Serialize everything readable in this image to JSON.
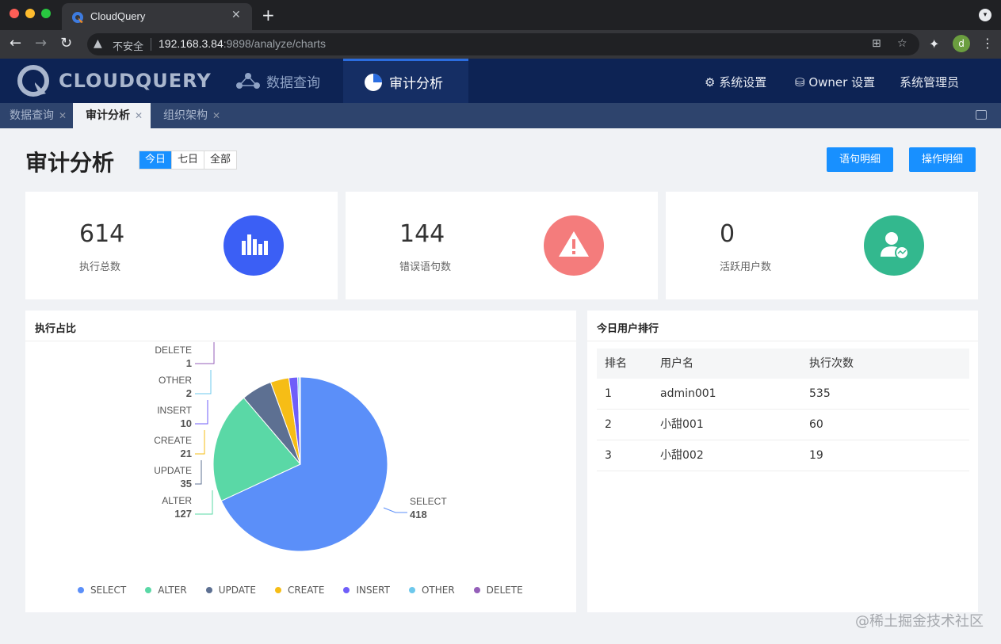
{
  "browser": {
    "tab_title": "CloudQuery",
    "insecure_label": "不安全",
    "url_host": "192.168.3.84",
    "url_rest": ":9898/analyze/charts",
    "profile_initial": "d"
  },
  "app": {
    "logo_text": "CLOUDQUERY",
    "nav": [
      "数据查询",
      "审计分析"
    ],
    "nav_right": [
      "系统设置",
      "Owner 设置",
      "系统管理员"
    ]
  },
  "page_tabs": [
    "数据查询",
    "审计分析",
    "组织架构"
  ],
  "page": {
    "title": "审计分析",
    "range_options": [
      "今日",
      "七日",
      "全部"
    ],
    "range_selected": "今日",
    "buttons": [
      "语句明细",
      "操作明细"
    ]
  },
  "stats": [
    {
      "value": "614",
      "label": "执行总数",
      "color": "#3b5ff5",
      "icon": "bar-chart-icon"
    },
    {
      "value": "144",
      "label": "错误语句数",
      "color": "#f47c7c",
      "icon": "warning-icon"
    },
    {
      "value": "0",
      "label": "活跃用户数",
      "color": "#33b88e",
      "icon": "user-activity-icon"
    }
  ],
  "pie_panel": {
    "title": "执行占比"
  },
  "ranking": {
    "title": "今日用户排行",
    "headers": [
      "排名",
      "用户名",
      "执行次数"
    ],
    "rows": [
      [
        "1",
        "admin001",
        "535"
      ],
      [
        "2",
        "小甜001",
        "60"
      ],
      [
        "3",
        "小甜002",
        "19"
      ]
    ]
  },
  "chart_data": {
    "type": "pie",
    "categories": [
      "SELECT",
      "ALTER",
      "UPDATE",
      "CREATE",
      "INSERT",
      "OTHER",
      "DELETE"
    ],
    "values": [
      418,
      127,
      35,
      21,
      10,
      2,
      1
    ],
    "colors": [
      "#5b8ff9",
      "#5ad8a6",
      "#5d7092",
      "#f6bd16",
      "#6f5ef9",
      "#6dc8ec",
      "#945fb9"
    ],
    "legend": "bottom"
  },
  "watermark": "@稀土掘金技术社区"
}
